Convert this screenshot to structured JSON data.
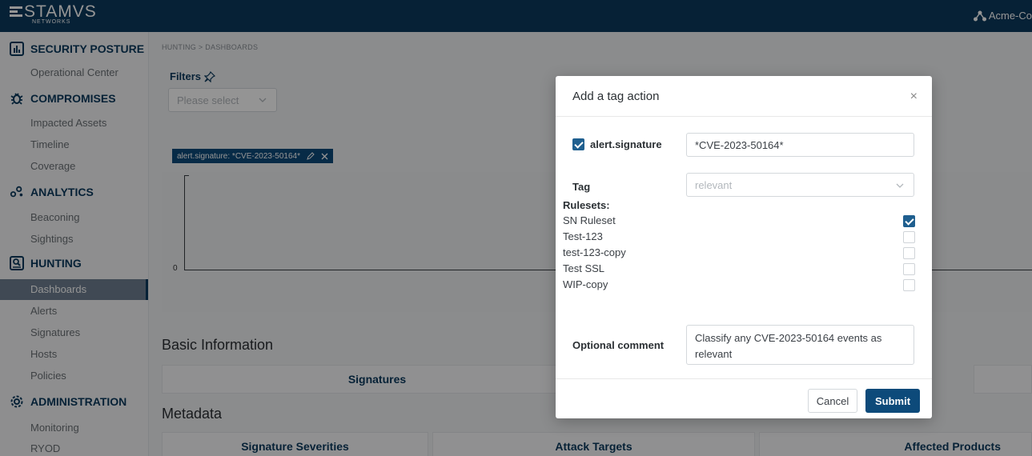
{
  "brand": {
    "name": "STAMVS",
    "sub": "NETWORKS"
  },
  "tenant": "Acme-Co",
  "sidebar": {
    "sections": [
      {
        "label": "SECURITY POSTURE",
        "icon": "bar-chart-icon",
        "items": [
          "Operational Center"
        ]
      },
      {
        "label": "COMPROMISES",
        "icon": "bug-icon",
        "items": [
          "Impacted Assets",
          "Timeline",
          "Coverage"
        ]
      },
      {
        "label": "ANALYTICS",
        "icon": "nodes-icon",
        "items": [
          "Beaconing",
          "Sightings"
        ]
      },
      {
        "label": "HUNTING",
        "icon": "hunting-icon",
        "items": [
          "Dashboards",
          "Alerts",
          "Signatures",
          "Hosts",
          "Policies"
        ]
      },
      {
        "label": "ADMINISTRATION",
        "icon": "gear-icon",
        "items": [
          "Monitoring",
          "RYOD"
        ]
      }
    ],
    "active": "Dashboards"
  },
  "main": {
    "breadcrumb": "HUNTING  >  DASHBOARDS",
    "filters_title": "Filters",
    "filter_placeholder": "Please select",
    "active_filter": "alert.signature: *CVE-2023-50164*",
    "chart_zero": "0",
    "basic_info_title": "Basic Information",
    "basic_panels": [
      "Signatures"
    ],
    "metadata_title": "Metadata",
    "metadata_panels": [
      "Signature Severities",
      "Attack Targets",
      "Affected Products"
    ]
  },
  "modal": {
    "title": "Add a tag action",
    "close": "×",
    "field_label": "alert.signature",
    "field_checked": true,
    "field_value": "*CVE-2023-50164*",
    "tag_label": "Tag",
    "tag_placeholder": "relevant",
    "rulesets_label": "Rulesets:",
    "rulesets": [
      {
        "name": "SN Ruleset",
        "checked": true
      },
      {
        "name": "Test-123",
        "checked": false
      },
      {
        "name": "test-123-copy",
        "checked": false
      },
      {
        "name": "Test SSL",
        "checked": false
      },
      {
        "name": "WIP-copy",
        "checked": false
      }
    ],
    "comment_label": "Optional comment",
    "comment_value": "Classify any CVE-2023-50164 events as relevant",
    "cancel_label": "Cancel",
    "submit_label": "Submit"
  }
}
